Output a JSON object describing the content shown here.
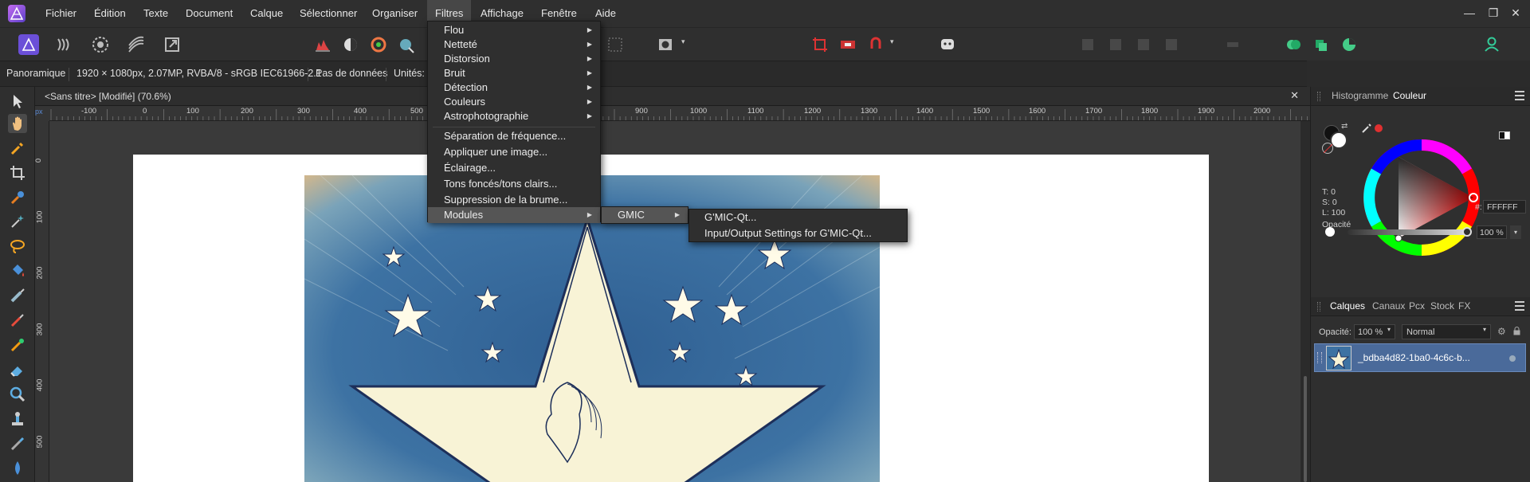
{
  "menubar": {
    "items": [
      "Fichier",
      "Édition",
      "Texte",
      "Document",
      "Calque",
      "Sélectionner",
      "Organiser",
      "Filtres",
      "Affichage",
      "Fenêtre",
      "Aide"
    ],
    "active": "Filtres",
    "window_controls": [
      "—",
      "❐",
      "✕"
    ]
  },
  "context_bar": {
    "tool": "Panoramique",
    "doc_info": "1920 × 1080px, 2.07MP, RVBA/8 - sRGB IEC61966-2.1",
    "data_status": "Pas de données",
    "units_label": "Unités:"
  },
  "document": {
    "tab_title": "<Sans titre> [Modifié] (70.6%)",
    "close": "✕",
    "ruler_unit": "px",
    "h_ticks": [
      "-100",
      "0",
      "100",
      "200",
      "300",
      "400",
      "500",
      "900",
      "1000",
      "1100",
      "1200",
      "1300",
      "1400",
      "1500",
      "1600",
      "1700",
      "1800",
      "1900",
      "2000"
    ],
    "v_ticks": [
      "0",
      "100",
      "200",
      "300",
      "400",
      "500"
    ]
  },
  "filters_menu": {
    "items": [
      {
        "label": "Flou",
        "submenu": true
      },
      {
        "label": "Netteté",
        "submenu": true
      },
      {
        "label": "Distorsion",
        "submenu": true
      },
      {
        "label": "Bruit",
        "submenu": true
      },
      {
        "label": "Détection",
        "submenu": true
      },
      {
        "label": "Couleurs",
        "submenu": true
      },
      {
        "label": "Astrophotographie",
        "submenu": true
      },
      {
        "label": "Séparation de fréquence...",
        "submenu": false
      },
      {
        "label": "Appliquer une image...",
        "submenu": false
      },
      {
        "label": "Éclairage...",
        "submenu": false
      },
      {
        "label": "Tons foncés/tons clairs...",
        "submenu": false
      },
      {
        "label": "Suppression de la brume...",
        "submenu": false
      },
      {
        "label": "Modules",
        "submenu": true
      }
    ]
  },
  "modules_menu": {
    "items": [
      {
        "label": "GMIC",
        "submenu": true
      }
    ]
  },
  "gmic_menu": {
    "items": [
      "G'MIC-Qt...",
      "Input/Output Settings for G'MIC-Qt..."
    ]
  },
  "color_panel": {
    "tabs": [
      "Histogramme",
      "Couleur"
    ],
    "active_tab": "Couleur",
    "readouts": {
      "t": "T: 0",
      "s": "S: 0",
      "l": "L: 100"
    },
    "hex_label": "#:",
    "hex_value": "FFFFFF",
    "opacity_label": "Opacité",
    "opacity_value": "100 %",
    "colors": {
      "hue_marker": "#ff0000",
      "accent": "#e03030"
    }
  },
  "layers_panel": {
    "tabs": [
      "Calques",
      "Canaux",
      "Pcx",
      "Stock",
      "FX"
    ],
    "active_tab": "Calques",
    "opacity_label": "Opacité:",
    "opacity_value": "100 %",
    "blend_mode": "Normal",
    "layers": [
      {
        "name": "_bdba4d82-1ba0-4c6c-b..."
      }
    ]
  }
}
